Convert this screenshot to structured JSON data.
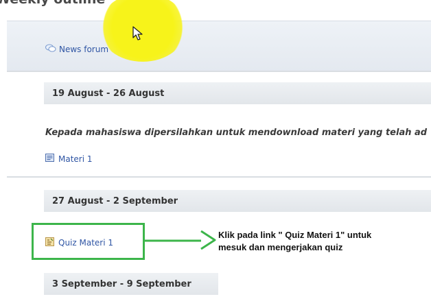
{
  "page": {
    "heading": "Weekly outline"
  },
  "sections": [
    {
      "resource": {
        "label": "News forum",
        "icon": "forum-icon"
      }
    },
    {
      "date_range": "19 August - 26 August",
      "description": "Kepada mahasiswa dipersilahkan untuk mendownload materi yang telah ad",
      "resource": {
        "label": "Materi 1",
        "icon": "document-icon"
      }
    },
    {
      "date_range": "27 August - 2 September",
      "resource": {
        "label": "Quiz Materi 1",
        "icon": "quiz-icon"
      }
    },
    {
      "date_range": "3 September - 9 September"
    }
  ],
  "annotation": {
    "line1": "Klik pada link \"  Quiz Materi 1\" untuk",
    "line2": "mesuk dan mengerjakan quiz"
  },
  "colors": {
    "link": "#2f55a4",
    "highlight": "#3cb54a",
    "cursor_highlight": "#f7f31a"
  }
}
